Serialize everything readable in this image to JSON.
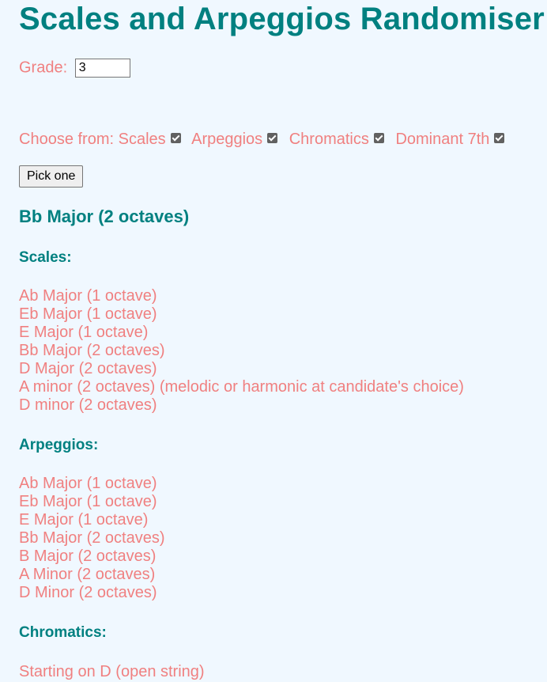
{
  "title": "Scales and Arpeggios Randomiser",
  "grade": {
    "label": "Grade:",
    "value": "3"
  },
  "choose": {
    "label": "Choose from:",
    "options": [
      {
        "label": "Scales",
        "checked": true
      },
      {
        "label": "Arpeggios",
        "checked": true
      },
      {
        "label": "Chromatics",
        "checked": true
      },
      {
        "label": "Dominant 7th",
        "checked": true
      }
    ]
  },
  "pick_button": "Pick one",
  "result": "Bb Major (2 octaves)",
  "sections": [
    {
      "heading": "Scales:",
      "items": [
        "Ab Major (1 octave)",
        "Eb Major (1 octave)",
        "E Major (1 octave)",
        "Bb Major (2 octaves)",
        "D Major (2 octaves)",
        "A minor (2 octaves) (melodic or harmonic at candidate's choice)",
        "D minor (2 octaves)"
      ]
    },
    {
      "heading": "Arpeggios:",
      "items": [
        "Ab Major (1 octave)",
        "Eb Major (1 octave)",
        "E Major (1 octave)",
        "Bb Major (2 octaves)",
        "B Major (2 octaves)",
        "A Minor (2 octaves)",
        "D Minor (2 octaves)"
      ]
    },
    {
      "heading": "Chromatics:",
      "items": [
        "Starting on D (open string)"
      ]
    }
  ]
}
